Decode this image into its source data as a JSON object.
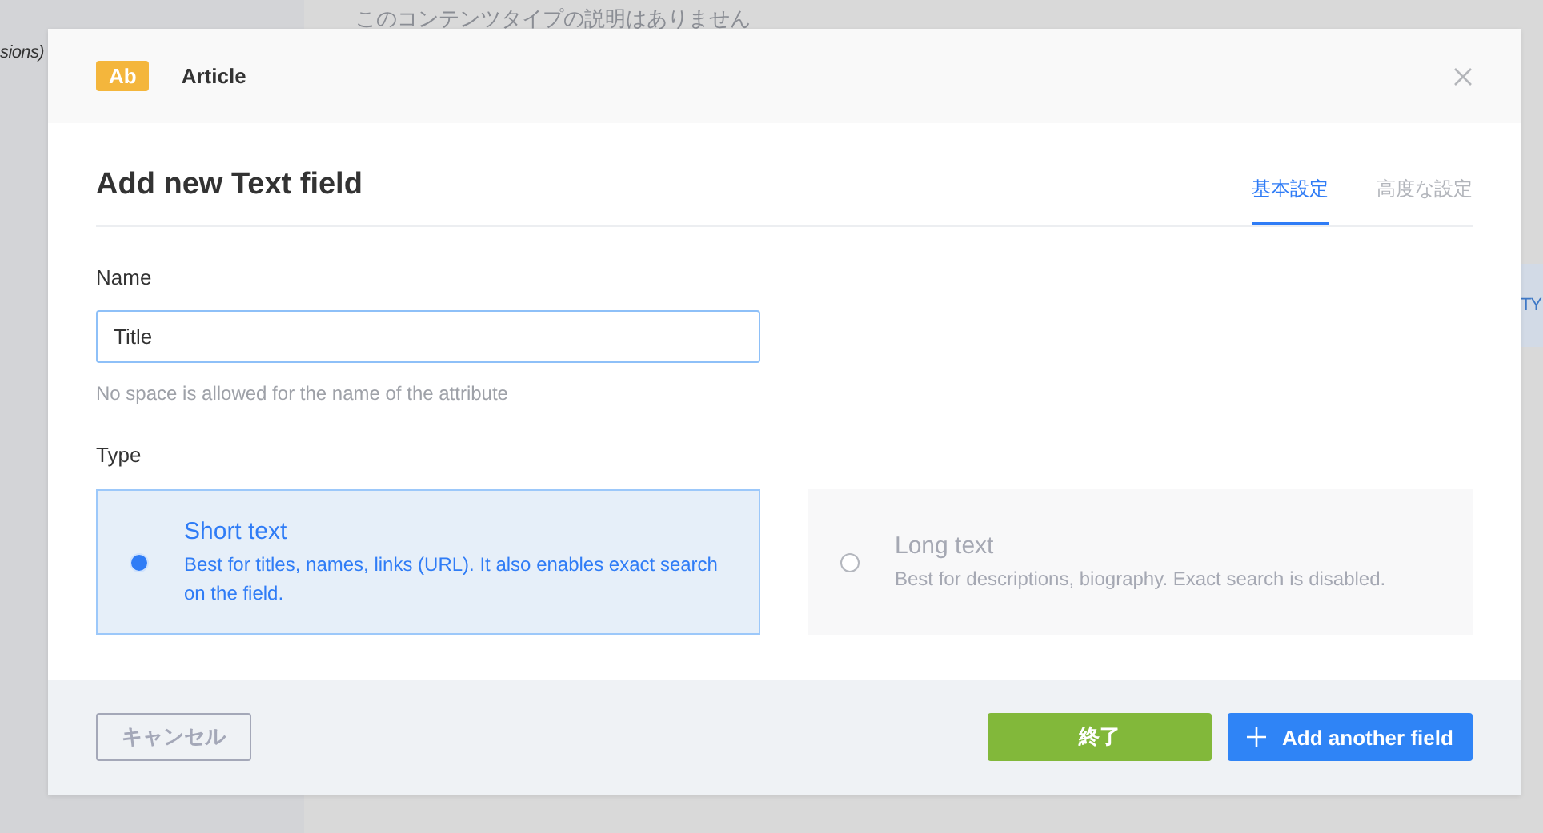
{
  "background": {
    "sidebar_text": "sions)",
    "description": "このコンテンツタイプの説明はありません",
    "edge_text": "TY"
  },
  "modal": {
    "badge": "Ab",
    "content_type": "Article",
    "title": "Add new Text field",
    "tabs": [
      {
        "label": "基本設定",
        "selected": true
      },
      {
        "label": "高度な設定",
        "selected": false
      }
    ],
    "name_label": "Name",
    "name_value": "Title",
    "name_hint": "No space is allowed for the name of the attribute",
    "type_label": "Type",
    "types": [
      {
        "title": "Short text",
        "description": "Best for titles, names, links (URL). It also enables exact search on the field.",
        "selected": true
      },
      {
        "title": "Long text",
        "description": "Best for descriptions, biography. Exact search is disabled.",
        "selected": false
      }
    ],
    "cancel": "キャンセル",
    "finish": "終了",
    "add_another": "Add another field"
  }
}
